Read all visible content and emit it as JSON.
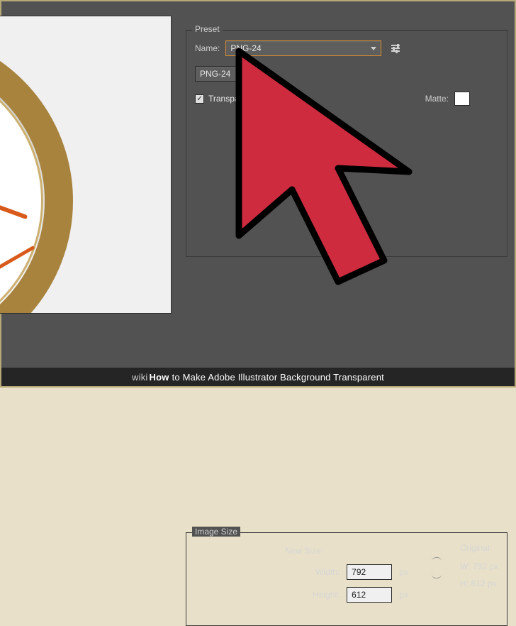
{
  "preset": {
    "group_label": "Preset",
    "name_label": "Name:",
    "name_value": "PNG-24",
    "format_value": "PNG-24",
    "transparency_label": "Transparency",
    "transparency_checked": true,
    "matte_label": "Matte:"
  },
  "image_size": {
    "group_label": "Image Size",
    "new_size_label": "New Size:",
    "width_label": "Width:",
    "height_label": "Height:",
    "px_unit": "px",
    "width_value": "792",
    "height_value": "612",
    "original_label": "Original:",
    "original_width_label": "W:",
    "original_width_value": "792 px",
    "original_height_label": "H:",
    "original_height_value": "612 px"
  },
  "watermark": {
    "prefix": "wiki",
    "how": "How",
    "rest": "to Make Adobe Illustrator Background Transparent"
  },
  "colors": {
    "panel_bg": "#525252",
    "accent": "#d68b2e",
    "cursor_fill": "#cf2b3f",
    "cursor_stroke": "#000000"
  }
}
